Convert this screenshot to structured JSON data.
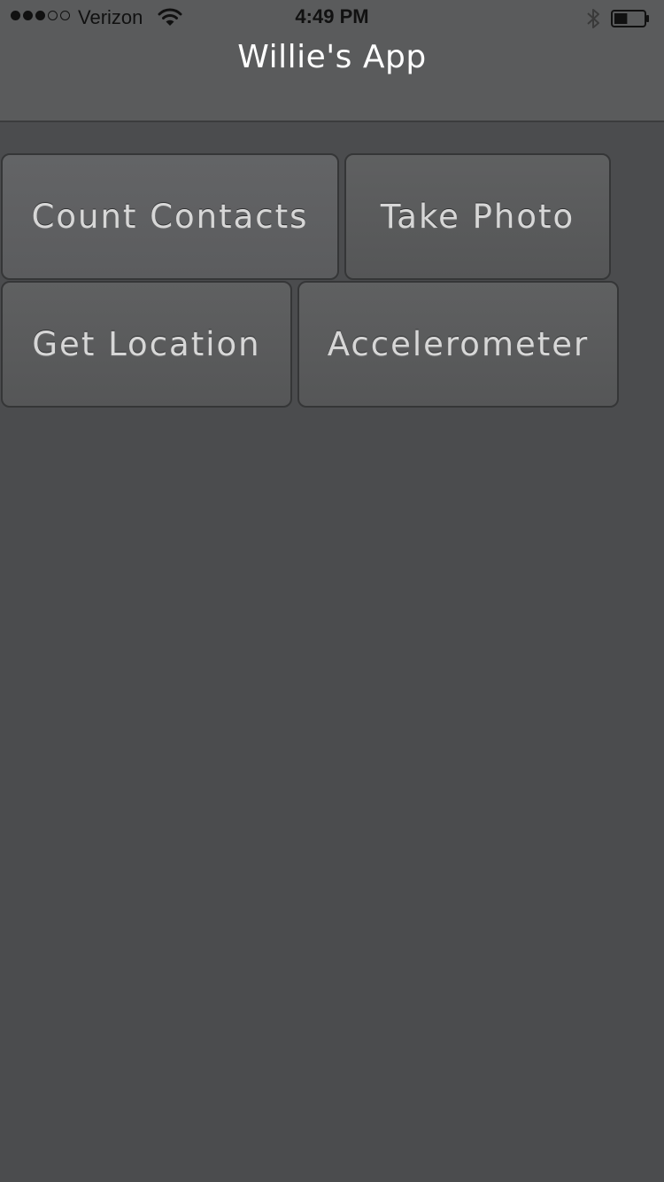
{
  "status_bar": {
    "signal_filled": 3,
    "signal_total": 5,
    "carrier": "Verizon",
    "time": "4:49 PM",
    "icons": [
      "wifi-icon",
      "bluetooth-icon",
      "battery-icon"
    ],
    "battery_level": 0.45
  },
  "header": {
    "title": "Willie's App"
  },
  "buttons": {
    "count_contacts": "Count Contacts",
    "take_photo": "Take Photo",
    "get_location": "Get Location",
    "accelerometer": "Accelerometer"
  },
  "colors": {
    "background": "#4b4c4e",
    "header": "#5a5b5c",
    "button_text": "#d7d7d7"
  }
}
